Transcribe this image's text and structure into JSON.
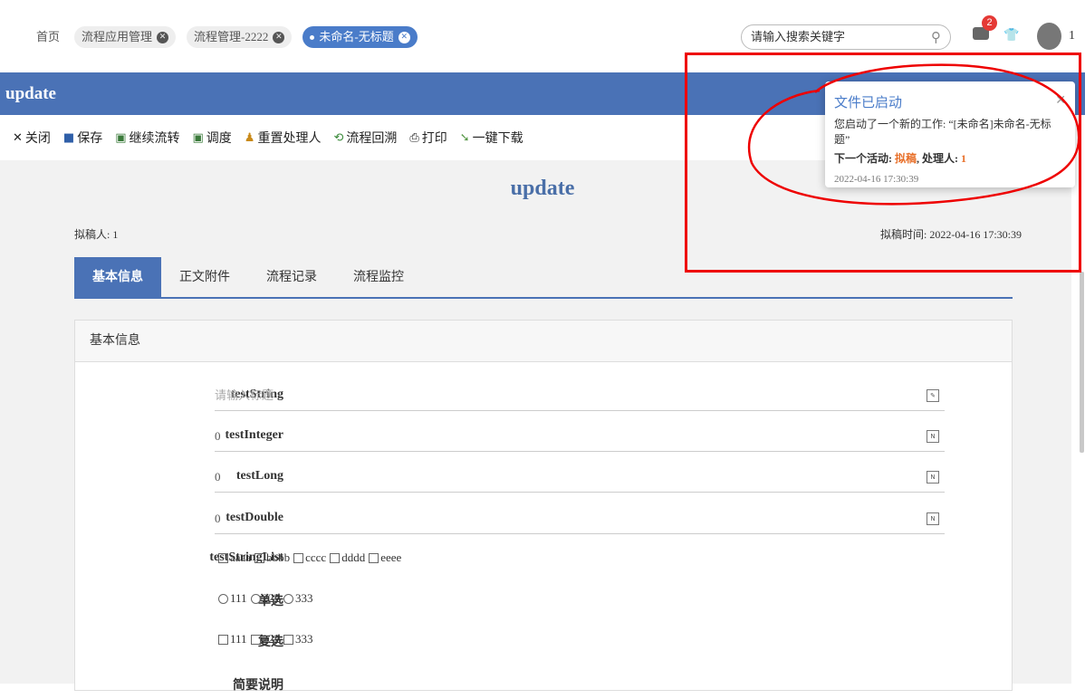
{
  "tabs": [
    {
      "label": "首页",
      "closable": false,
      "active": false
    },
    {
      "label": "流程应用管理",
      "closable": true,
      "active": false
    },
    {
      "label": "流程管理-2222",
      "closable": true,
      "active": false
    },
    {
      "label": "未命名-无标题",
      "closable": true,
      "active": true
    }
  ],
  "search": {
    "placeholder": "请输入搜索关键字"
  },
  "user": {
    "message_count": "2",
    "name": "1"
  },
  "header": {
    "title": "update"
  },
  "toolbar": {
    "close": "关闭",
    "save": "保存",
    "continue": "继续流转",
    "dispatch": "调度",
    "reset_handler": "重置处理人",
    "flow_back": "流程回溯",
    "print": "打印",
    "download": "一键下载"
  },
  "doc": {
    "title": "update",
    "drafter": "拟稿人: 1",
    "draft_time": "拟稿时间: 2022-04-16 17:30:39"
  },
  "form_tabs": [
    "基本信息",
    "正文附件",
    "流程记录",
    "流程监控"
  ],
  "panel": {
    "title": "基本信息"
  },
  "fields": {
    "testString": {
      "label": "testString",
      "placeholder": "请输入标题",
      "value": ""
    },
    "testInteger": {
      "label": "testInteger",
      "value": "0"
    },
    "testLong": {
      "label": "testLong",
      "value": "0"
    },
    "testDouble": {
      "label": "testDouble",
      "value": "0"
    },
    "testStringList": {
      "label": "testStringList",
      "options": [
        "aaaa",
        "bbbb",
        "cccc",
        "dddd",
        "eeee"
      ]
    },
    "single": {
      "label": "单选",
      "options": [
        "111",
        "222",
        "333"
      ]
    },
    "multi": {
      "label": "复选",
      "options": [
        "111",
        "222",
        "333"
      ]
    },
    "description": {
      "label": "简要说明"
    }
  },
  "notification": {
    "title": "文件已启动",
    "body": "您启动了一个新的工作: “[未命名]未命名-无标题”",
    "next_prefix": "下一个活动: ",
    "next_activity": "拟稿",
    "handler_prefix": ", 处理人: ",
    "handler": "1",
    "time": "2022-04-16 17:30:39"
  },
  "colors": {
    "accent": "#4a72b6",
    "highlight": "#e8702a",
    "annotation": "#ee0000"
  }
}
